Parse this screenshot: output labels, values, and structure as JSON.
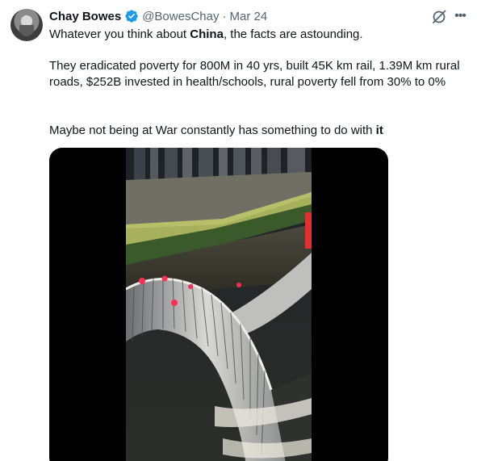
{
  "tweet": {
    "author_name": "Chay Bowes",
    "handle": "@BowesChay",
    "separator": "·",
    "date": "Mar 24",
    "paragraph1": {
      "pre": "Whatever you think about ",
      "bold": "China",
      "post": ", the facts are astounding."
    },
    "paragraph2": "They eradicated poverty for 800M in 40 yrs, built 45K km rail, 1.39M km rural roads,  $252B invested in health/schools, rural poverty fell from 30% to 0%",
    "paragraph3": {
      "pre": "Maybe not being at War constantly has something to do with ",
      "bold": "it"
    }
  },
  "icons": {
    "verified": "verified-badge-icon",
    "grok": "grok-icon",
    "more": "more-options-icon"
  },
  "colors": {
    "verified_blue": "#1d9bf0",
    "secondary_text": "#536471",
    "primary_text": "#0f1419"
  }
}
